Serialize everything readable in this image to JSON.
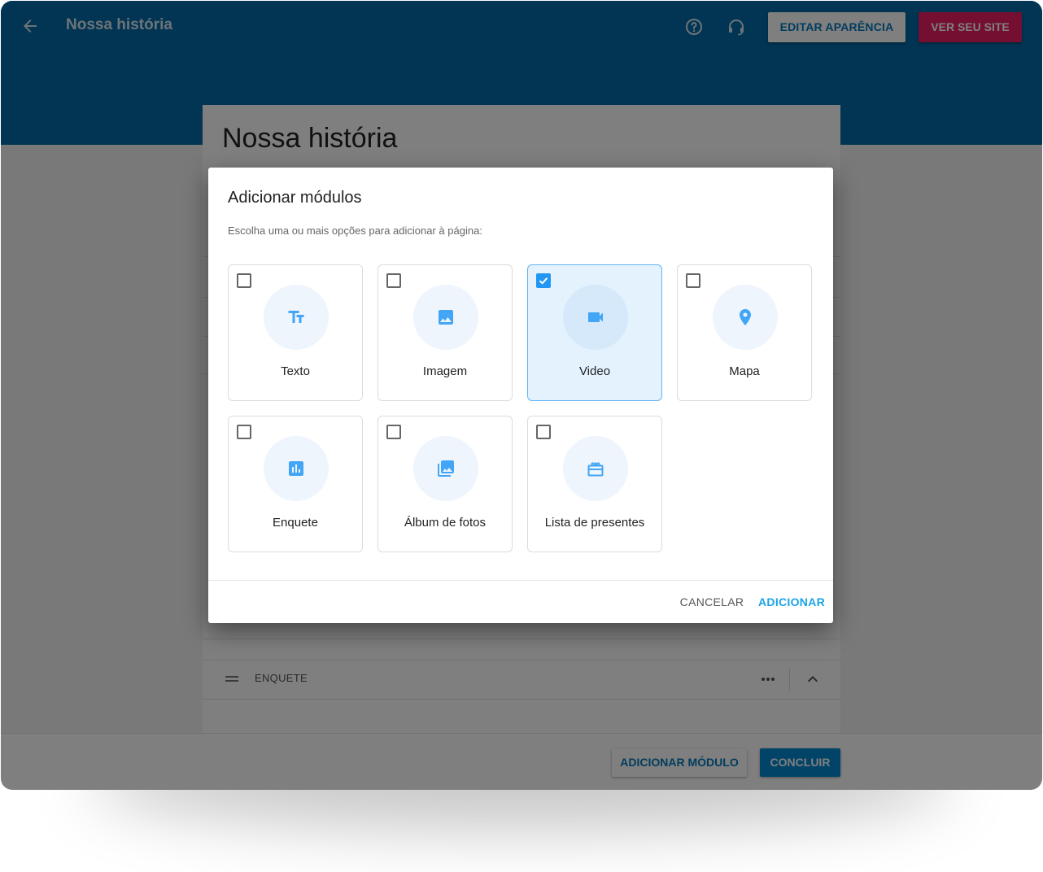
{
  "app_bar": {
    "title": "Nossa história",
    "edit_button": "EDITAR APARÊNCIA",
    "view_button": "VER SEU SITE"
  },
  "page": {
    "title": "Nossa história",
    "module_row_label": "ENQUETE"
  },
  "bottom_bar": {
    "add_module_button": "ADICIONAR MÓDULO",
    "finish_button": "CONCLUIR"
  },
  "dialog": {
    "title": "Adicionar módulos",
    "subtitle": "Escolha uma ou mais opções para adicionar à página:",
    "modules": [
      {
        "label": "Texto",
        "icon": "text-fields-icon",
        "checked": false
      },
      {
        "label": "Imagem",
        "icon": "image-icon",
        "checked": false
      },
      {
        "label": "Video",
        "icon": "videocam-icon",
        "checked": true
      },
      {
        "label": "Mapa",
        "icon": "map-pin-icon",
        "checked": false
      },
      {
        "label": "Enquete",
        "icon": "poll-icon",
        "checked": false
      },
      {
        "label": "Álbum de fotos",
        "icon": "photo-library-icon",
        "checked": false
      },
      {
        "label": "Lista de presentes",
        "icon": "gift-icon",
        "checked": false
      }
    ],
    "cancel_button": "CANCELAR",
    "add_button": "ADICIONAR"
  },
  "colors": {
    "primary": "#026aa7",
    "accent": "#e91e63",
    "selected_tile": "#e3f2fd",
    "icon_blue": "#42a5f5",
    "link_blue": "#1aa3e8"
  }
}
